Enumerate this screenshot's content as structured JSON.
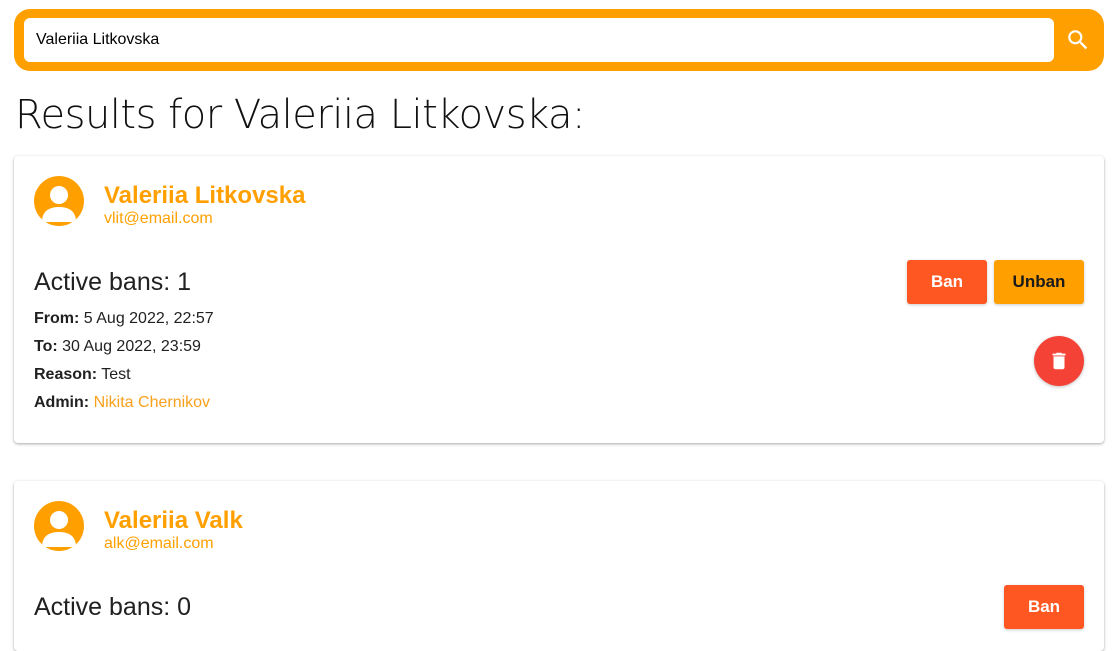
{
  "search": {
    "value": "Valeriia Litkovska",
    "icon": "search-icon"
  },
  "results_title": "Results for Valeriia Litkovska:",
  "colors": {
    "accent": "#ffa000",
    "ban": "#ff5722",
    "delete": "#f44336"
  },
  "users": [
    {
      "name": "Valeriia Litkovska",
      "email": "vlit@email.com",
      "active_bans": "Active bans: 1",
      "ban": {
        "from_label": "From:",
        "from_value": "5 Aug 2022, 22:57",
        "to_label": "To:",
        "to_value": "30 Aug 2022, 23:59",
        "reason_label": "Reason:",
        "reason_value": "Test",
        "admin_label": "Admin:",
        "admin_value": "Nikita Chernikov"
      },
      "ban_label": "Ban",
      "unban_label": "Unban",
      "delete_icon": "trash-icon"
    },
    {
      "name": "Valeriia Valk",
      "email": "alk@email.com",
      "active_bans": "Active bans: 0",
      "ban_label": "Ban"
    }
  ]
}
